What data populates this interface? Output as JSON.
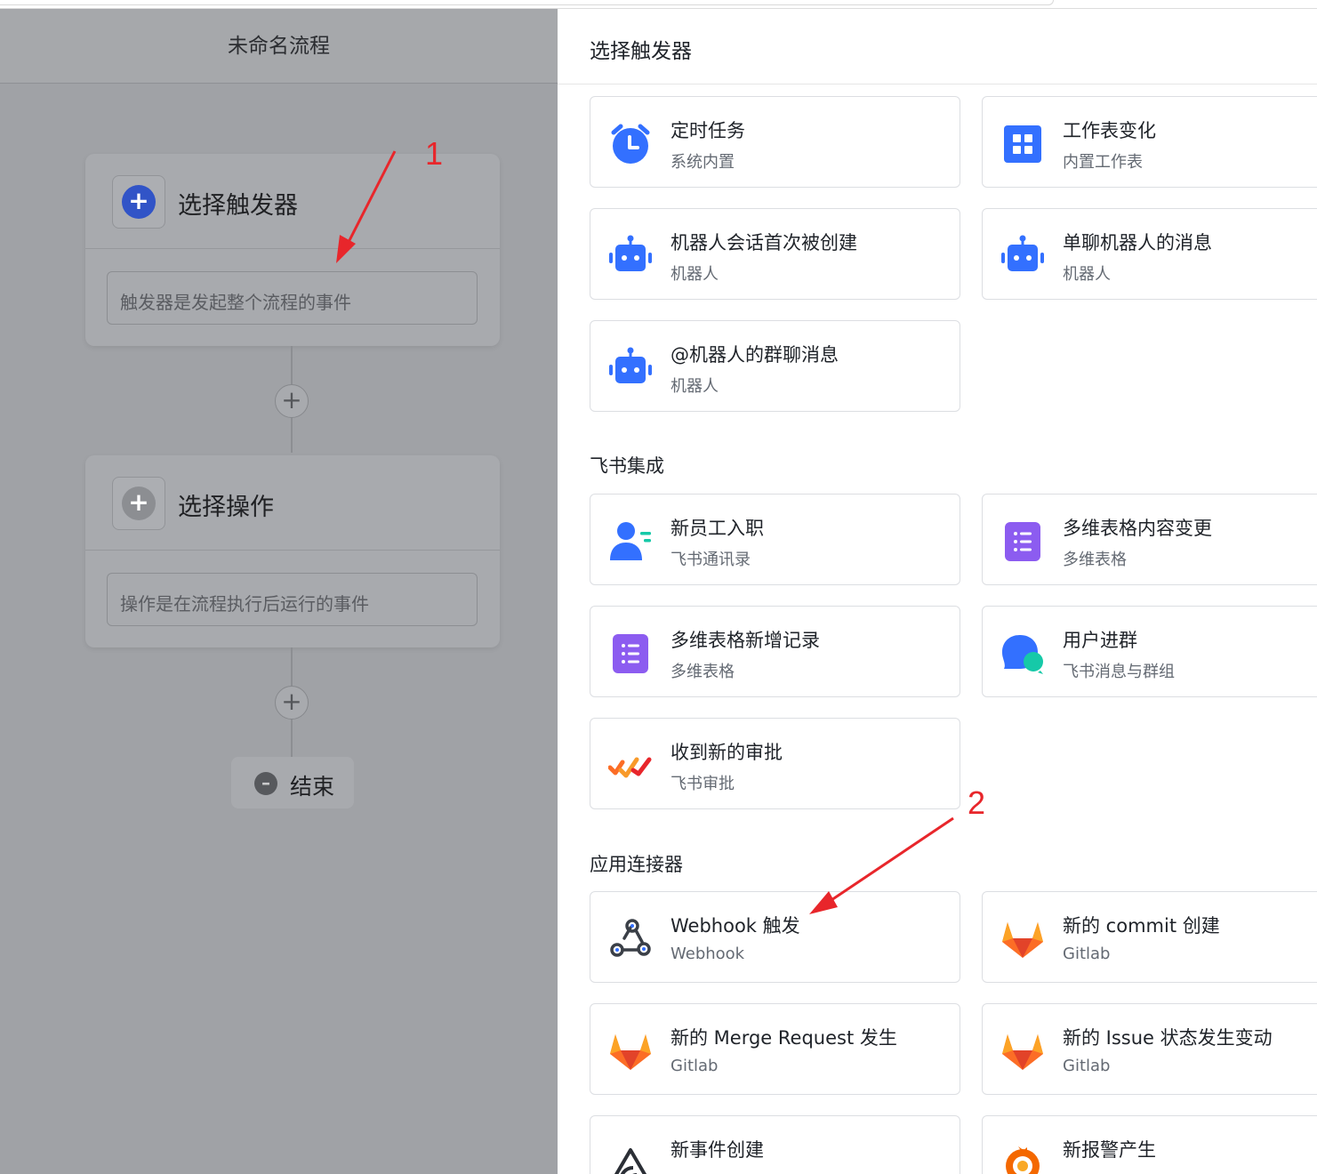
{
  "flow": {
    "title": "未命名流程",
    "trigger_node": {
      "title": "选择触发器",
      "hint": "触发器是发起整个流程的事件"
    },
    "action_node": {
      "title": "选择操作",
      "hint": "操作是在流程执行后运行的事件"
    },
    "end_label": "结束",
    "add_symbol": "+"
  },
  "annotations": {
    "one": "1",
    "two": "2"
  },
  "panel": {
    "title": "选择触发器",
    "sections": [
      {
        "label": "",
        "cards": [
          {
            "title": "定时任务",
            "subtitle": "系统内置",
            "icon": "alarm-clock-icon"
          },
          {
            "title": "工作表变化",
            "subtitle": "内置工作表",
            "icon": "grid-table-icon"
          },
          {
            "title": "机器人会话首次被创建",
            "subtitle": "机器人",
            "icon": "robot-icon"
          },
          {
            "title": "单聊机器人的消息",
            "subtitle": "机器人",
            "icon": "robot-icon"
          },
          {
            "title": "@机器人的群聊消息",
            "subtitle": "机器人",
            "icon": "robot-icon"
          }
        ]
      },
      {
        "label": "飞书集成",
        "cards": [
          {
            "title": "新员工入职",
            "subtitle": "飞书通讯录",
            "icon": "user-add-icon"
          },
          {
            "title": "多维表格内容变更",
            "subtitle": "多维表格",
            "icon": "bitable-icon"
          },
          {
            "title": "多维表格新增记录",
            "subtitle": "多维表格",
            "icon": "bitable-icon"
          },
          {
            "title": "用户进群",
            "subtitle": "飞书消息与群组",
            "icon": "chat-bubble-icon"
          },
          {
            "title": "收到新的审批",
            "subtitle": "飞书审批",
            "icon": "approval-icon"
          }
        ]
      },
      {
        "label": "应用连接器",
        "cards": [
          {
            "title": "Webhook 触发",
            "subtitle": "Webhook",
            "icon": "webhook-icon"
          },
          {
            "title": "新的 commit 创建",
            "subtitle": "Gitlab",
            "icon": "gitlab-icon"
          },
          {
            "title": "新的 Merge Request 发生",
            "subtitle": "Gitlab",
            "icon": "gitlab-icon"
          },
          {
            "title": "新的 Issue 状态发生变动",
            "subtitle": "Gitlab",
            "icon": "gitlab-icon"
          },
          {
            "title": "新事件创建",
            "subtitle": "",
            "icon": "sentry-icon"
          },
          {
            "title": "新报警产生",
            "subtitle": "",
            "icon": "grafana-icon"
          }
        ]
      }
    ]
  },
  "colors": {
    "accent": "#3370ff",
    "purple": "#8c5cf0",
    "gitlab": "#fc6d26",
    "teal": "#16c9a8"
  }
}
